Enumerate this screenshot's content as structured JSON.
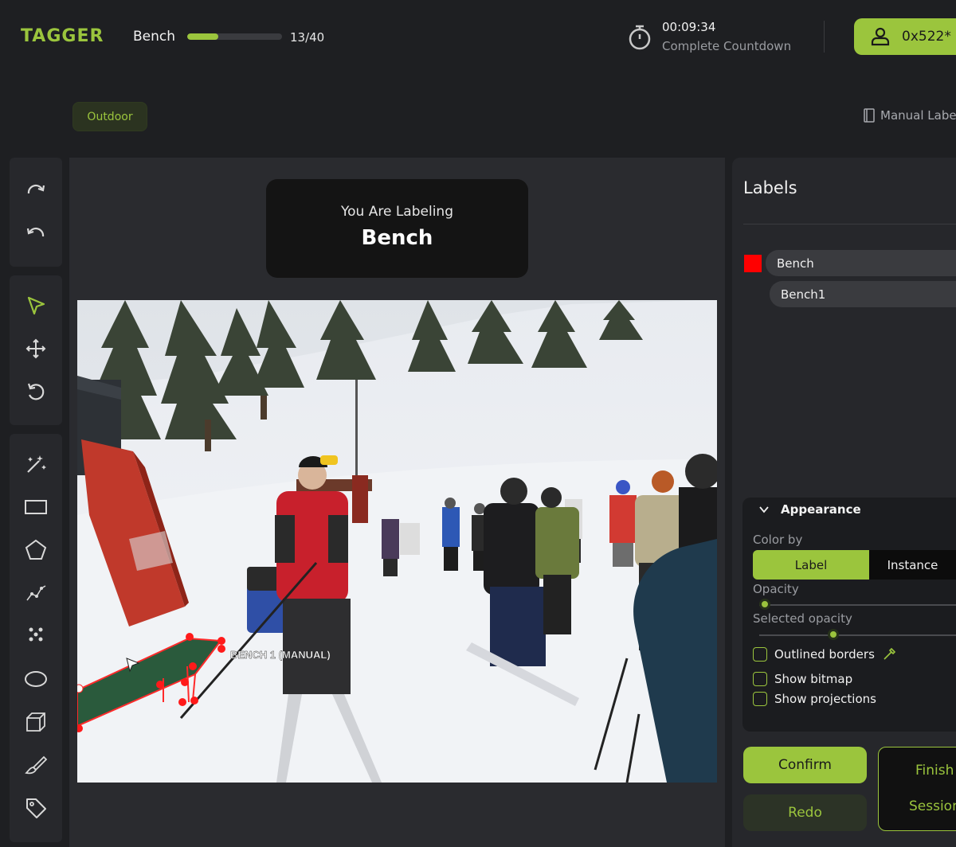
{
  "header": {
    "logo": "TAGGER",
    "project_name": "Bench",
    "progress_fraction": 0.325,
    "progress_text": "13/40",
    "timer": "00:09:34",
    "timer_label": "Complete Countdown",
    "user_id": "0x522*"
  },
  "category_chip": "Outdoor",
  "manual_link": "Manual Label",
  "toolbar": {
    "groups": [
      [
        "redo-icon",
        "undo-icon"
      ],
      [
        "select-arrow-icon",
        "move-icon",
        "rotate-icon"
      ],
      [
        "magic-wand-icon",
        "rectangle-icon",
        "polygon-icon",
        "polyline-icon",
        "points-icon",
        "ellipse-icon",
        "cuboid-icon",
        "brush-icon",
        "tag-icon"
      ]
    ]
  },
  "canvas": {
    "labeling_prefix": "You Are Labeling",
    "labeling_name": "Bench",
    "annotation_label": "BENCH 1 (MANUAL)"
  },
  "labels": {
    "title": "Labels",
    "items": [
      {
        "name": "Bench",
        "color": "#ff0000"
      },
      {
        "name": "Bench1"
      }
    ]
  },
  "appearance": {
    "title": "Appearance",
    "color_by_label": "Color by",
    "color_by_options": [
      "Label",
      "Instance"
    ],
    "color_by_selected": "Label",
    "opacity_label": "Opacity",
    "opacity_value": 0.0,
    "selected_opacity_label": "Selected opacity",
    "selected_opacity_value": 0.35,
    "checks": [
      {
        "label": "Outlined borders",
        "checked": false
      },
      {
        "label": "Show bitmap",
        "checked": false
      },
      {
        "label": "Show projections",
        "checked": false
      }
    ]
  },
  "actions": {
    "confirm": "Confirm",
    "redo": "Redo",
    "finish_line1": "Finish",
    "finish_line2": "Session"
  },
  "colors": {
    "accent": "#9bc53d",
    "background": "#1e1f22",
    "label_bench": "#ff0000"
  }
}
